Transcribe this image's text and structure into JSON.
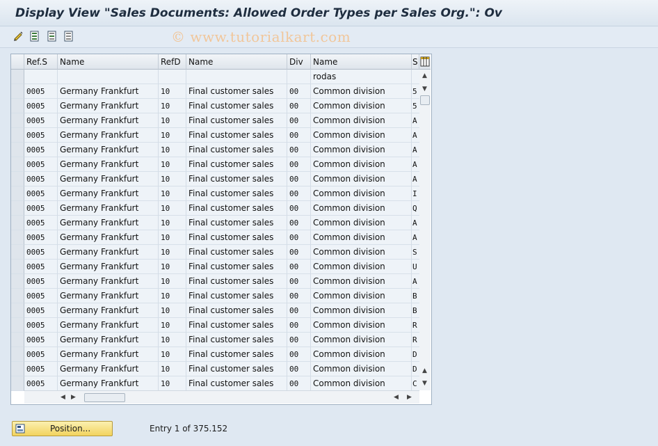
{
  "window": {
    "title": "Display View \"Sales Documents: Allowed Order Types per Sales Org.\": Ov"
  },
  "watermark": "© www.tutorialkart.com",
  "table": {
    "columns": [
      "Ref.S",
      "Name",
      "RefD",
      "Name",
      "Div",
      "Name",
      "S"
    ],
    "first_row": [
      "",
      "",
      "",
      "",
      "",
      "rodas",
      ""
    ],
    "rows": [
      [
        "0005",
        "Germany Frankfurt",
        "10",
        "Final customer sales",
        "00",
        "Common division",
        "5"
      ],
      [
        "0005",
        "Germany Frankfurt",
        "10",
        "Final customer sales",
        "00",
        "Common division",
        "5"
      ],
      [
        "0005",
        "Germany Frankfurt",
        "10",
        "Final customer sales",
        "00",
        "Common division",
        "A"
      ],
      [
        "0005",
        "Germany Frankfurt",
        "10",
        "Final customer sales",
        "00",
        "Common division",
        "A"
      ],
      [
        "0005",
        "Germany Frankfurt",
        "10",
        "Final customer sales",
        "00",
        "Common division",
        "A"
      ],
      [
        "0005",
        "Germany Frankfurt",
        "10",
        "Final customer sales",
        "00",
        "Common division",
        "A"
      ],
      [
        "0005",
        "Germany Frankfurt",
        "10",
        "Final customer sales",
        "00",
        "Common division",
        "A"
      ],
      [
        "0005",
        "Germany Frankfurt",
        "10",
        "Final customer sales",
        "00",
        "Common division",
        "I"
      ],
      [
        "0005",
        "Germany Frankfurt",
        "10",
        "Final customer sales",
        "00",
        "Common division",
        "Q"
      ],
      [
        "0005",
        "Germany Frankfurt",
        "10",
        "Final customer sales",
        "00",
        "Common division",
        "A"
      ],
      [
        "0005",
        "Germany Frankfurt",
        "10",
        "Final customer sales",
        "00",
        "Common division",
        "A"
      ],
      [
        "0005",
        "Germany Frankfurt",
        "10",
        "Final customer sales",
        "00",
        "Common division",
        "S"
      ],
      [
        "0005",
        "Germany Frankfurt",
        "10",
        "Final customer sales",
        "00",
        "Common division",
        "U"
      ],
      [
        "0005",
        "Germany Frankfurt",
        "10",
        "Final customer sales",
        "00",
        "Common division",
        "A"
      ],
      [
        "0005",
        "Germany Frankfurt",
        "10",
        "Final customer sales",
        "00",
        "Common division",
        "B"
      ],
      [
        "0005",
        "Germany Frankfurt",
        "10",
        "Final customer sales",
        "00",
        "Common division",
        "B"
      ],
      [
        "0005",
        "Germany Frankfurt",
        "10",
        "Final customer sales",
        "00",
        "Common division",
        "R"
      ],
      [
        "0005",
        "Germany Frankfurt",
        "10",
        "Final customer sales",
        "00",
        "Common division",
        "R"
      ],
      [
        "0005",
        "Germany Frankfurt",
        "10",
        "Final customer sales",
        "00",
        "Common division",
        "D"
      ],
      [
        "0005",
        "Germany Frankfurt",
        "10",
        "Final customer sales",
        "00",
        "Common division",
        "D"
      ],
      [
        "0005",
        "Germany Frankfurt",
        "10",
        "Final customer sales",
        "00",
        "Common division",
        "C"
      ]
    ]
  },
  "footer": {
    "position_label": "Position...",
    "entry_text": "Entry 1 of 375.152"
  },
  "icons": [
    "change-display-icon",
    "select-all-icon",
    "select-block-icon",
    "deselect-all-icon",
    "column-settings-icon",
    "position-icon"
  ],
  "colors": {
    "title_bar": "#dbe5ef",
    "table_cell": "#eef3f8",
    "position_button": "#f2d35e",
    "watermark": "#f1c69a"
  }
}
